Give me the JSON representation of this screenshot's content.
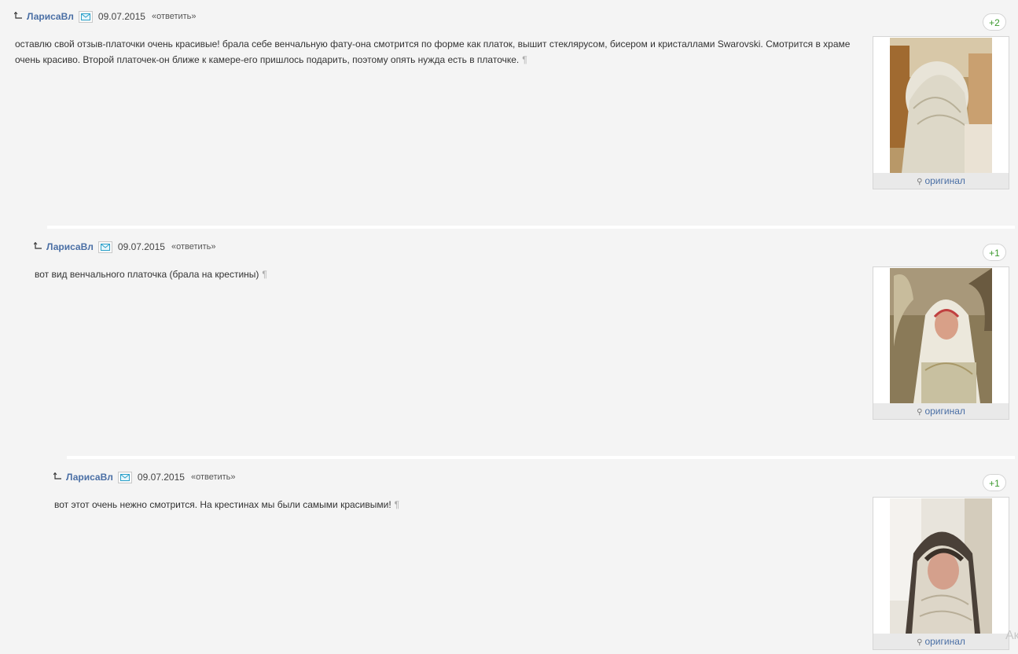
{
  "comments": [
    {
      "username": "ЛарисаВл",
      "date": "09.07.2015",
      "reply_label": "«ответить»",
      "votes": "+2",
      "text": "оставлю свой отзыв-платочки очень красивые! брала себе венчальную фату-она смотрится по форме как платок, вышит стеклярусом, бисером и кристаллами Swarovski. Смотрится в храме очень красиво. Второй платочек-он ближе к камере-его пришлось подарить, поэтому опять нужда есть в платочке.",
      "pilcrow": "¶",
      "original_label": "оригинал"
    },
    {
      "username": "ЛарисаВл",
      "date": "09.07.2015",
      "reply_label": "«ответить»",
      "votes": "+1",
      "text": "вот вид венчального платочка (брала на крестины)",
      "pilcrow": "¶",
      "original_label": "оригинал"
    },
    {
      "username": "ЛарисаВл",
      "date": "09.07.2015",
      "reply_label": "«ответить»",
      "votes": "+1",
      "text": "вот этот очень нежно смотрится. На крестинах мы были самыми красивыми!",
      "pilcrow": "¶",
      "original_label": "оригинал"
    }
  ],
  "icons": {
    "reply": "reply-arrow-icon",
    "mail": "mail-icon",
    "magnifier": "magnifier-icon"
  },
  "colors": {
    "username": "#4a6fa5",
    "vote_positive": "#3d9a2f",
    "background": "#f4f4f4"
  },
  "edge_text": "Ак"
}
